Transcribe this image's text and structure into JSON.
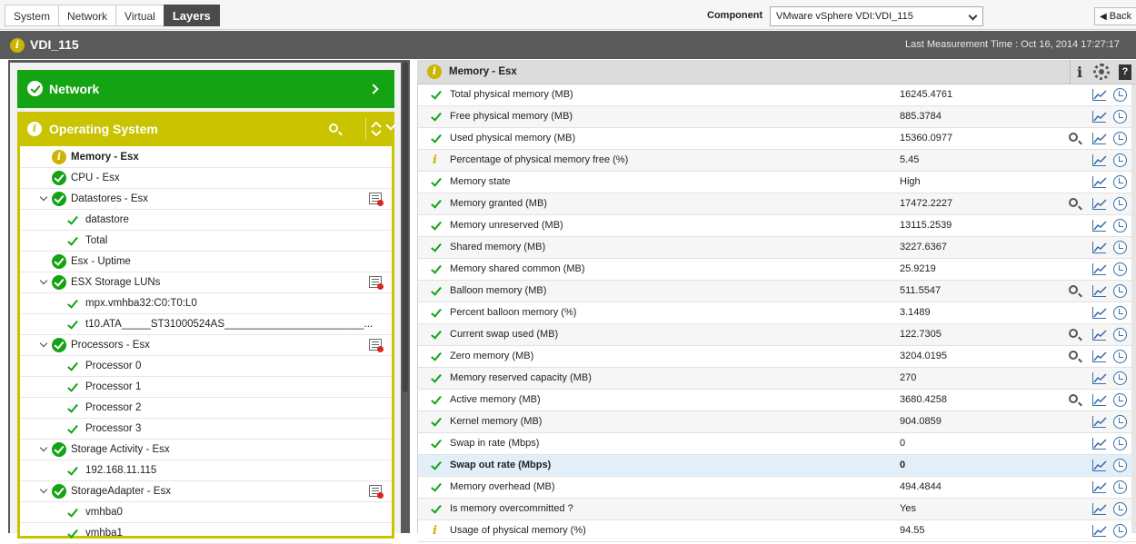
{
  "tabs": [
    "System",
    "Network",
    "Virtual",
    "Layers"
  ],
  "active_tab": "Layers",
  "component": {
    "label": "Component",
    "value": "VMware vSphere VDI:VDI_115"
  },
  "back_label": "Back",
  "page_title": "VDI_115",
  "last_measurement": "Last Measurement Time : Oct 16, 2014 17:27:17",
  "layers": {
    "network": "Network",
    "os": "Operating System"
  },
  "tree": [
    {
      "label": "Memory - Esx",
      "level": 0,
      "status": "info",
      "bold": true,
      "expandable": false,
      "report": false
    },
    {
      "label": "CPU - Esx",
      "level": 0,
      "status": "ok",
      "bold": false,
      "expandable": false,
      "report": false
    },
    {
      "label": "Datastores - Esx",
      "level": 0,
      "status": "ok",
      "bold": false,
      "expandable": true,
      "report": true
    },
    {
      "label": "datastore",
      "level": 1,
      "status": "tick",
      "bold": false,
      "expandable": false,
      "report": false
    },
    {
      "label": "Total",
      "level": 1,
      "status": "tick",
      "bold": false,
      "expandable": false,
      "report": false
    },
    {
      "label": "Esx - Uptime",
      "level": 0,
      "status": "ok",
      "bold": false,
      "expandable": false,
      "report": false
    },
    {
      "label": "ESX Storage LUNs",
      "level": 0,
      "status": "ok",
      "bold": false,
      "expandable": true,
      "report": true
    },
    {
      "label": "mpx.vmhba32:C0:T0:L0",
      "level": 1,
      "status": "tick",
      "bold": false,
      "expandable": false,
      "report": false
    },
    {
      "label": "t10.ATA_____ST31000524AS________________________...",
      "level": 1,
      "status": "tick",
      "bold": false,
      "expandable": false,
      "report": false
    },
    {
      "label": "Processors - Esx",
      "level": 0,
      "status": "ok",
      "bold": false,
      "expandable": true,
      "report": true
    },
    {
      "label": "Processor 0",
      "level": 1,
      "status": "tick",
      "bold": false,
      "expandable": false,
      "report": false
    },
    {
      "label": "Processor 1",
      "level": 1,
      "status": "tick",
      "bold": false,
      "expandable": false,
      "report": false
    },
    {
      "label": "Processor 2",
      "level": 1,
      "status": "tick",
      "bold": false,
      "expandable": false,
      "report": false
    },
    {
      "label": "Processor 3",
      "level": 1,
      "status": "tick",
      "bold": false,
      "expandable": false,
      "report": false
    },
    {
      "label": "Storage Activity - Esx",
      "level": 0,
      "status": "ok",
      "bold": false,
      "expandable": true,
      "report": false
    },
    {
      "label": "192.168.11.115",
      "level": 1,
      "status": "tick",
      "bold": false,
      "expandable": false,
      "report": false
    },
    {
      "label": "StorageAdapter - Esx",
      "level": 0,
      "status": "ok",
      "bold": false,
      "expandable": true,
      "report": true
    },
    {
      "label": "vmhba0",
      "level": 1,
      "status": "tick",
      "bold": false,
      "expandable": false,
      "report": false
    },
    {
      "label": "vmhba1",
      "level": 1,
      "status": "tick",
      "bold": false,
      "expandable": false,
      "report": false
    }
  ],
  "metrics_header": "Memory - Esx",
  "metrics": [
    {
      "name": "Total physical memory (MB)",
      "value": "16245.4761",
      "status": "ok",
      "detail": false
    },
    {
      "name": "Free physical memory (MB)",
      "value": "885.3784",
      "status": "ok",
      "detail": false
    },
    {
      "name": "Used physical memory (MB)",
      "value": "15360.0977",
      "status": "ok",
      "detail": true
    },
    {
      "name": "Percentage of physical memory free (%)",
      "value": "5.45",
      "status": "info",
      "detail": false
    },
    {
      "name": "Memory state",
      "value": "High",
      "status": "ok",
      "detail": false
    },
    {
      "name": "Memory granted (MB)",
      "value": "17472.2227",
      "status": "ok",
      "detail": true
    },
    {
      "name": "Memory unreserved (MB)",
      "value": "13115.2539",
      "status": "ok",
      "detail": false
    },
    {
      "name": "Shared memory (MB)",
      "value": "3227.6367",
      "status": "ok",
      "detail": false
    },
    {
      "name": "Memory shared common (MB)",
      "value": "25.9219",
      "status": "ok",
      "detail": false
    },
    {
      "name": "Balloon memory (MB)",
      "value": "511.5547",
      "status": "ok",
      "detail": true
    },
    {
      "name": "Percent balloon memory (%)",
      "value": "3.1489",
      "status": "ok",
      "detail": false
    },
    {
      "name": "Current swap used (MB)",
      "value": "122.7305",
      "status": "ok",
      "detail": true
    },
    {
      "name": "Zero memory (MB)",
      "value": "3204.0195",
      "status": "ok",
      "detail": true
    },
    {
      "name": "Memory reserved capacity (MB)",
      "value": "270",
      "status": "ok",
      "detail": false
    },
    {
      "name": "Active memory (MB)",
      "value": "3680.4258",
      "status": "ok",
      "detail": true
    },
    {
      "name": "Kernel memory (MB)",
      "value": "904.0859",
      "status": "ok",
      "detail": false
    },
    {
      "name": "Swap in rate (Mbps)",
      "value": "0",
      "status": "ok",
      "detail": false
    },
    {
      "name": "Swap out rate (Mbps)",
      "value": "0",
      "status": "ok",
      "detail": false,
      "selected": true
    },
    {
      "name": "Memory overhead (MB)",
      "value": "494.4844",
      "status": "ok",
      "detail": false
    },
    {
      "name": "Is memory overcommitted ?",
      "value": "Yes",
      "status": "ok",
      "detail": false
    },
    {
      "name": "Usage of physical memory (%)",
      "value": "94.55",
      "status": "info",
      "detail": false
    }
  ]
}
